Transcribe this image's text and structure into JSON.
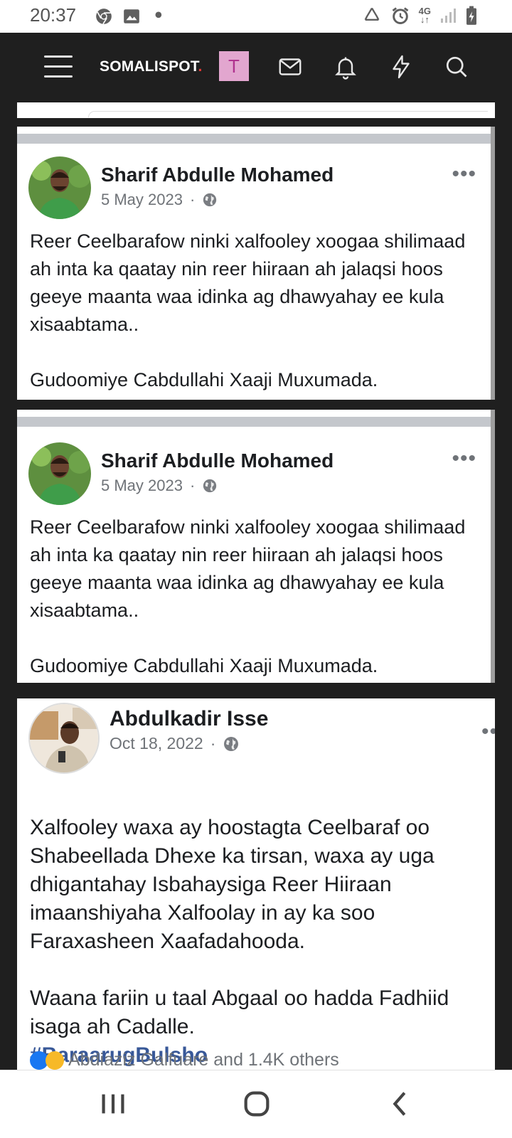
{
  "status_bar": {
    "time": "20:37",
    "network_label": "4G",
    "left_icons": [
      "chrome-icon",
      "image-icon",
      "dot-icon"
    ],
    "right_icons": [
      "recycle-icon",
      "alarm-icon",
      "signal-icon",
      "battery-icon"
    ]
  },
  "navbar": {
    "logo_text": "SOMALISPOT",
    "logo_dot": ".",
    "avatar_letter": "T",
    "icons": [
      "menu-icon",
      "mail-icon",
      "bell-icon",
      "lightning-icon",
      "search-icon"
    ]
  },
  "posts": [
    {
      "author": "Sharif Abdulle Mohamed",
      "date": "5 May 2023",
      "separator": "·",
      "more": "•••",
      "text": "Reer Ceelbarafow ninki xalfooley xoogaa shilimaad ah inta ka qaatay nin reer hiiraan ah jalaqsi hoos geeye maanta waa idinka ag dhawyahay ee kula xisaabtama..\n\nGudoomiye Cabdullahi Xaaji Muxumada."
    },
    {
      "author": "Sharif Abdulle Mohamed",
      "date": "5 May 2023",
      "separator": "·",
      "more": "•••",
      "text": "Reer Ceelbarafow ninki xalfooley xoogaa shilimaad ah inta ka qaatay nin reer hiiraan ah jalaqsi hoos geeye maanta waa idinka ag dhawyahay ee kula xisaabtama..\n\nGudoomiye Cabdullahi Xaaji Muxumada."
    },
    {
      "author": "Abdulkadir Isse",
      "date": "Oct 18, 2022",
      "separator": "·",
      "more": "••",
      "text": "Xalfooley waxa ay hoostagta Ceelbaraf oo Shabeellada Dhexe ka tirsan, waxa ay uga dhigantahay Isbahaysiga Reer Hiiraan imaanshiyaha Xalfoolay in ay ka soo Faraxasheen Xaafadahooda.\n\nWaana fariin u taal Abgaal oo hadda Fadhiid isaga ah Cadalle.",
      "hashtag": "#BaraarugBulsho",
      "reactions_text": "Abdiaziz Galfuare and 1.4K others"
    }
  ],
  "bottom_nav": {
    "icons": [
      "recents-icon",
      "home-icon",
      "back-icon"
    ]
  },
  "colors": {
    "nav_bg": "#1f1f1f",
    "avatar_bg": "#e2a6cf",
    "hashtag": "#385898",
    "divider": "#c4c7cc"
  }
}
